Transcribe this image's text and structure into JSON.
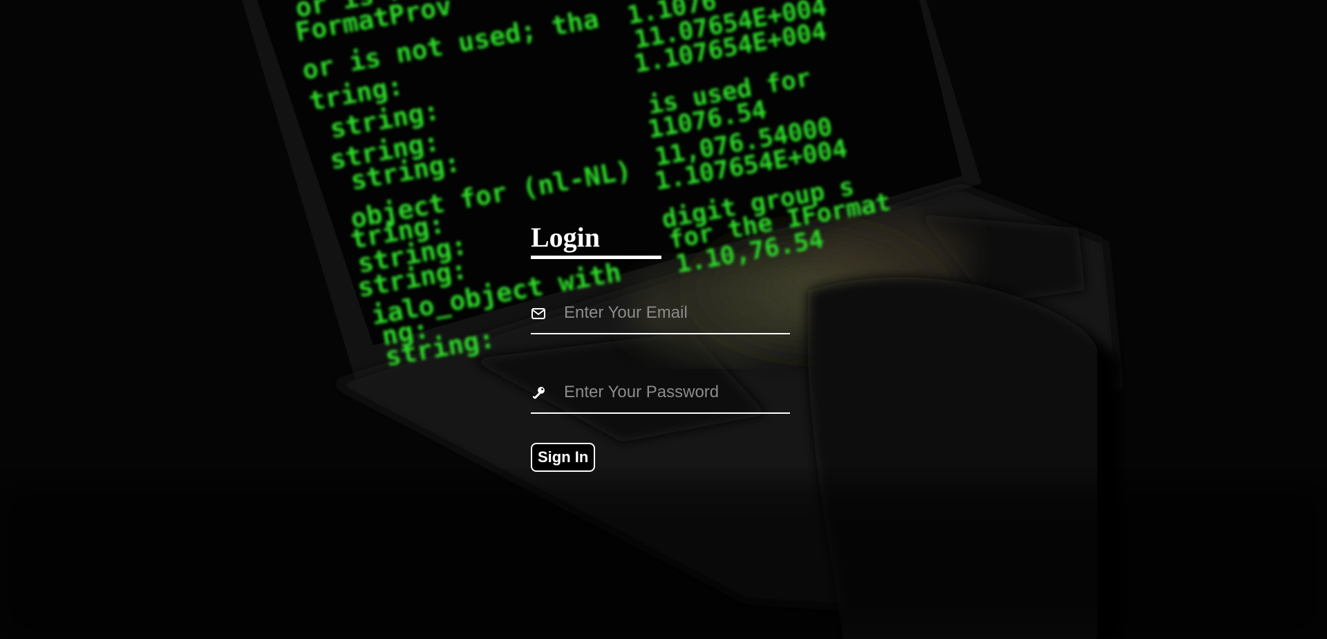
{
  "login": {
    "title": "Login",
    "email": {
      "placeholder": "Enter Your Email",
      "icon": "envelope-icon"
    },
    "password": {
      "placeholder": "Enter Your Password",
      "icon": "key-icon"
    },
    "submit_label": "Sign In"
  },
  "background": {
    "icon": "laptop-hacker-photo",
    "screen_text_color": "#39ff14"
  }
}
